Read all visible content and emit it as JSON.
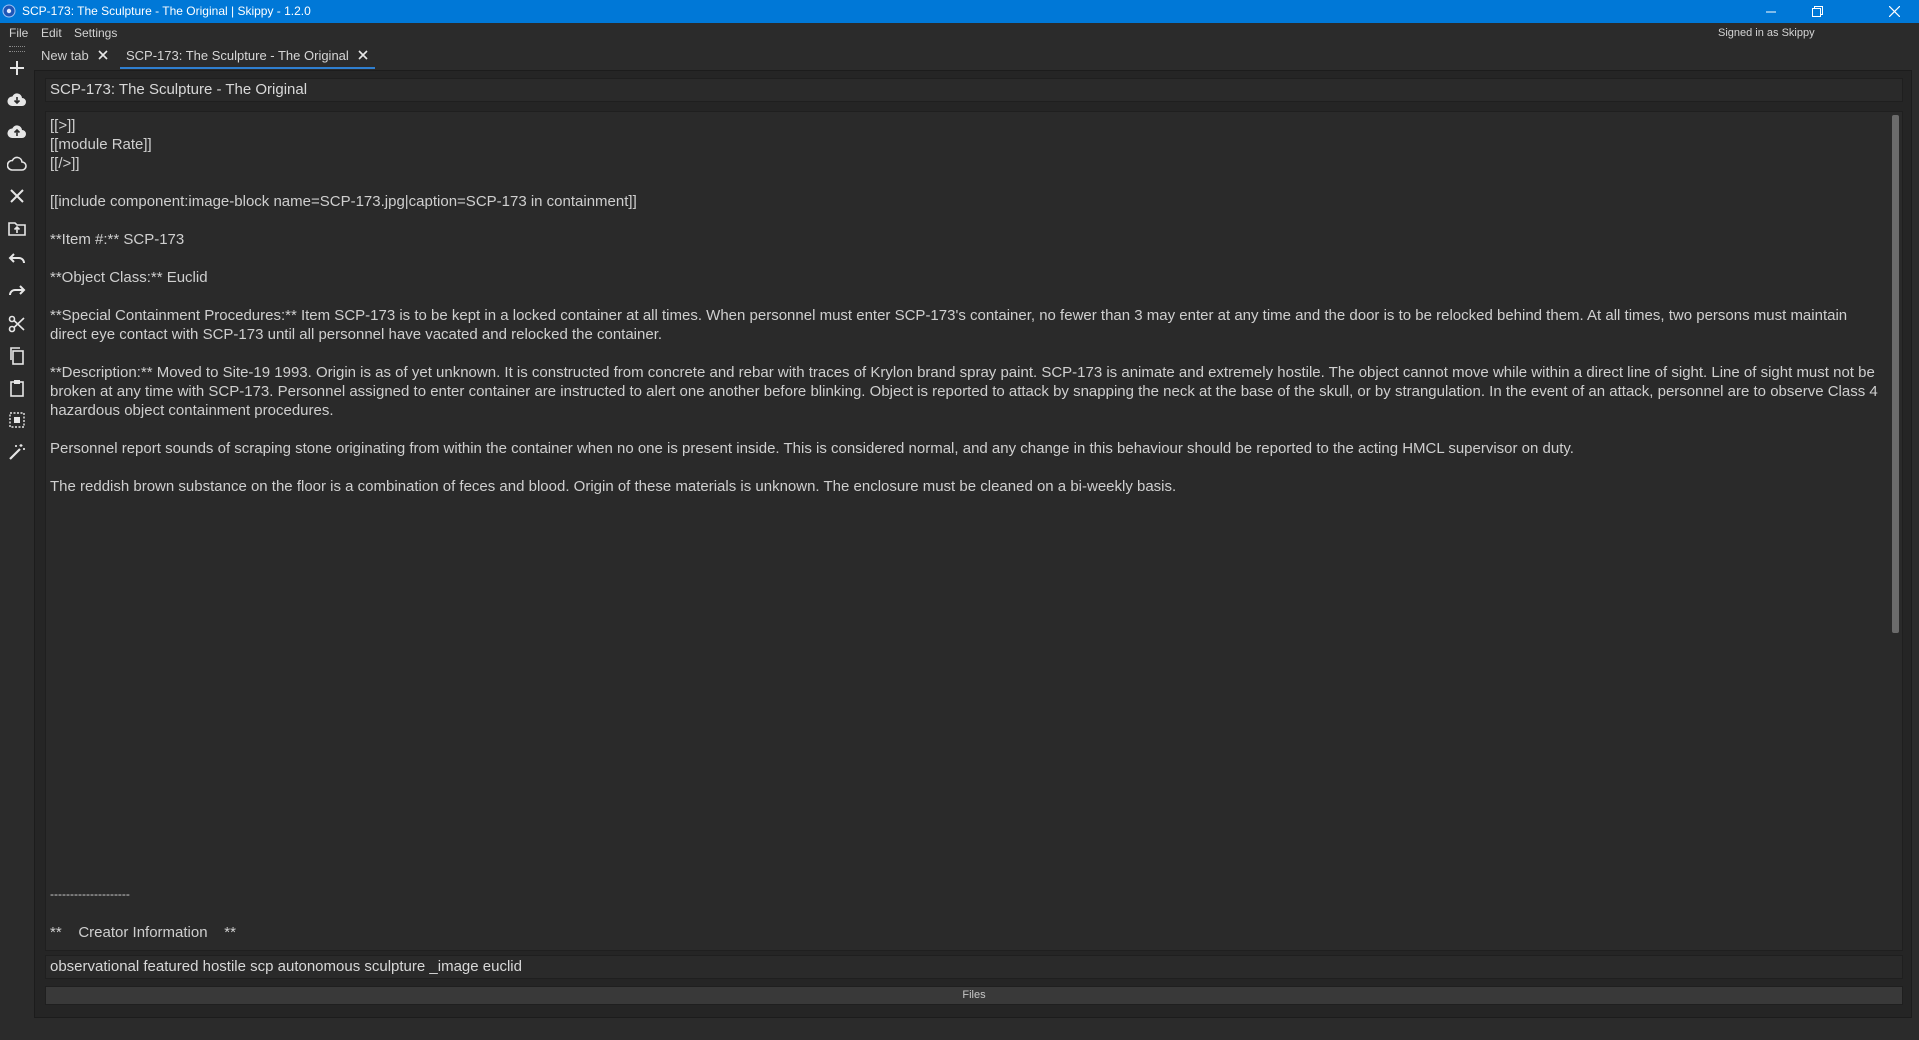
{
  "window": {
    "title": "SCP-173: The Sculpture - The Original | Skippy - 1.2.0",
    "accent": "#0078d7",
    "controls": [
      "minimize-icon",
      "restore-icon",
      "close-icon"
    ]
  },
  "menu": {
    "items": [
      "File",
      "Edit",
      "Settings"
    ],
    "signed_in": "Signed in as Skippy"
  },
  "toolbar": {
    "tools": [
      "add-icon",
      "cloud-download-icon",
      "cloud-upload-icon",
      "cloud-icon",
      "close-icon",
      "folder-upload-icon",
      "undo-icon",
      "redo-icon",
      "cut-icon",
      "copy-icon",
      "paste-icon",
      "select-all-icon",
      "magic-wand-icon"
    ]
  },
  "tabs": [
    {
      "label": "New tab",
      "active": false
    },
    {
      "label": "SCP-173: The Sculpture - The Original",
      "active": true
    }
  ],
  "editor": {
    "page_title": "SCP-173: The Sculpture - The Original",
    "lines": [
      "[[>]]",
      "[[module Rate]]",
      "[[/>]]",
      "",
      "[[include component:image-block name=SCP-173.jpg|caption=SCP-173 in containment]]",
      "",
      "**Item #:** SCP-173",
      "",
      "**Object Class:** Euclid",
      "",
      "**Special Containment Procedures:** Item SCP-173 is to be kept in a locked container at all times. When personnel must enter SCP-173's container, no fewer than 3 may enter at any time and the door is to be relocked behind them. At all times, two persons must maintain direct eye contact with SCP-173 until all personnel have vacated and relocked the container.",
      "",
      "**Description:** Moved to Site-19 1993. Origin is as of yet unknown. It is constructed from concrete and rebar with traces of Krylon brand spray paint. SCP-173 is animate and extremely hostile. The object cannot move while within a direct line of sight. Line of sight must not be broken at any time with SCP-173. Personnel assigned to enter container are instructed to alert one another before blinking. Object is reported to attack by snapping the neck at the base of the skull, or by strangulation. In the event of an attack, personnel are to observe Class 4 hazardous object containment procedures.",
      "",
      "Personnel report sounds of scraping stone originating from within the container when no one is present inside. This is considered normal, and any change in this behaviour should be reported to the acting HMCL supervisor on duty.",
      "",
      "The reddish brown substance on the floor is a combination of feces and blood. Origin of these materials is unknown. The enclosure must be cleaned on a bi-weekly basis."
    ],
    "footer_lines": [
      "--------------------",
      "",
      "**    Creator Information    **"
    ],
    "tags": "observational featured hostile scp autonomous sculpture _image euclid",
    "files_button": "Files"
  }
}
